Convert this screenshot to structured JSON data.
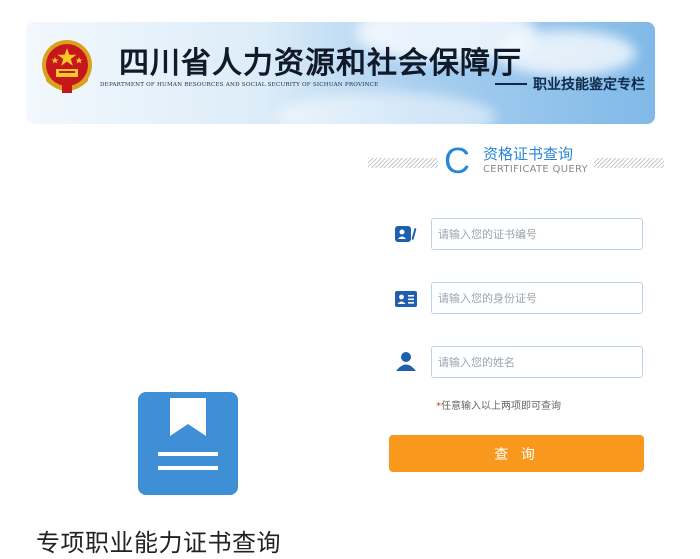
{
  "header": {
    "org_title": "四川省人力资源和社会保障厅",
    "org_subtitle": "DEPARTMENT OF HUMAN RESOURCES AND SOCIAL SECURITY OF SICHUAN PROVINCE",
    "column_label": "职业技能鉴定专栏",
    "emblem_icon": "national-emblem-icon"
  },
  "query": {
    "title": "资格证书查询",
    "subtitle": "CERTIFICATE QUERY",
    "fields": [
      {
        "icon": "certificate-card-icon",
        "placeholder": "请输入您的证书编号",
        "value": ""
      },
      {
        "icon": "id-card-icon",
        "placeholder": "请输入您的身份证号",
        "value": ""
      },
      {
        "icon": "user-icon",
        "placeholder": "请输入您的姓名",
        "value": ""
      }
    ],
    "hint_star": "*",
    "hint_text": "任意输入以上两项即可查询",
    "button_label": "查 询",
    "button_color": "#f8981d",
    "accent_color": "#2a86d6"
  },
  "card": {
    "icon": "bookmark-book-icon",
    "caption": "专项职业能力证书查询"
  }
}
